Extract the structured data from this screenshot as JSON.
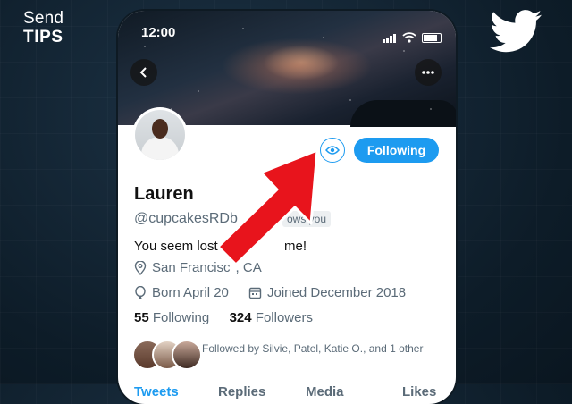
{
  "brand": {
    "line1": "Send",
    "line2": "TIPS",
    "twitter_logo": "twitter-bird-icon"
  },
  "status_bar": {
    "time": "12:00"
  },
  "profile": {
    "name": "Lauren",
    "handle": "@cupcakesRDb",
    "follows_you": "ows you",
    "bio": "You seem lost",
    "bio_end": "me!",
    "location": "San Francisc",
    "location_end": ", CA",
    "born": "Born April 20",
    "joined": "Joined December 2018",
    "following_count": "55",
    "following_label": "Following",
    "followers_count": "324",
    "followers_label": "Followers",
    "followed_by": "Followed by Silvie, Patel, Katie O., and 1 other"
  },
  "buttons": {
    "following": "Following"
  },
  "tabs": [
    "Tweets",
    "Replies",
    "Media",
    "Likes"
  ],
  "colors": {
    "accent": "#1d9bf0",
    "arrow": "#e8141c"
  }
}
